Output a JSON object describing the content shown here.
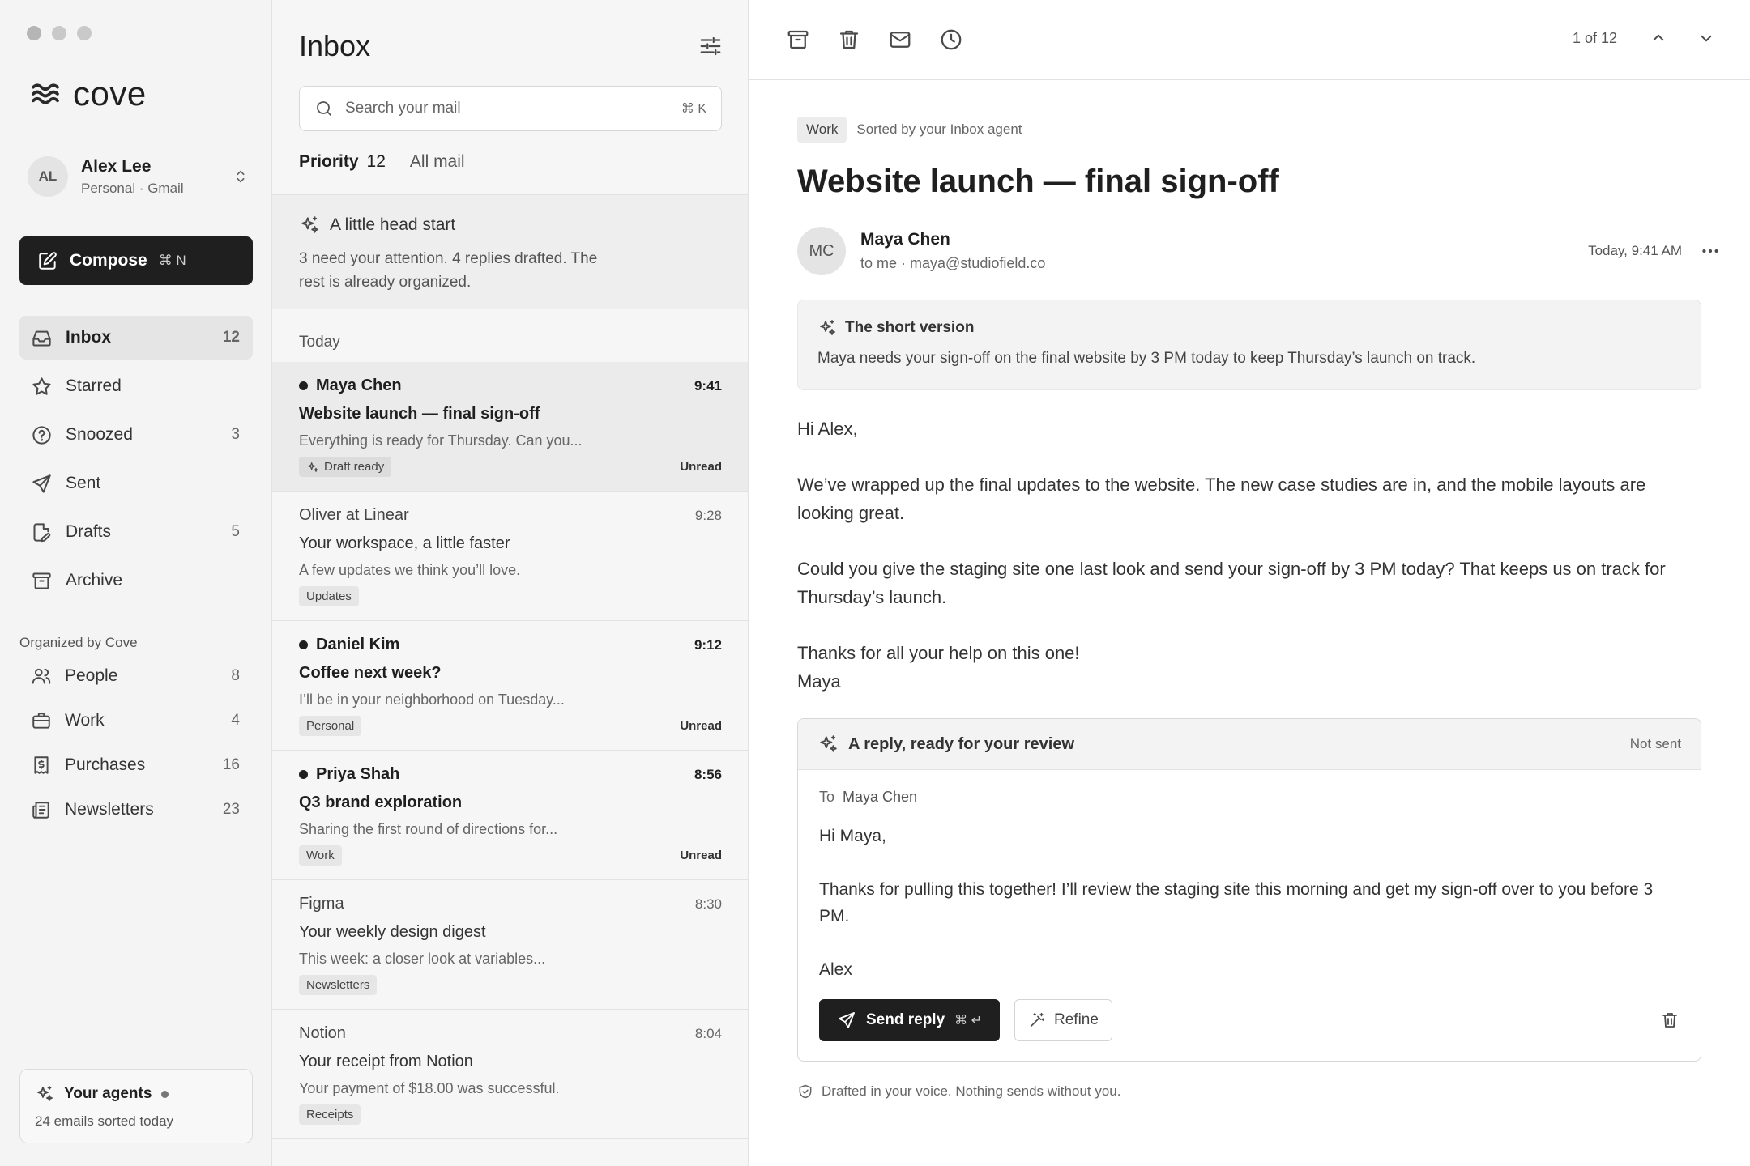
{
  "app": {
    "name": "cove"
  },
  "account": {
    "initials": "AL",
    "name": "Alex Lee",
    "sub": "Personal · Gmail"
  },
  "compose": {
    "label": "Compose",
    "shortcut": "⌘ N"
  },
  "nav": [
    {
      "label": "Inbox",
      "count": "12",
      "icon": "inbox-icon",
      "active": true
    },
    {
      "label": "Starred",
      "count": "",
      "icon": "star-icon"
    },
    {
      "label": "Snoozed",
      "count": "3",
      "icon": "clock-icon"
    },
    {
      "label": "Sent",
      "count": "",
      "icon": "send-icon"
    },
    {
      "label": "Drafts",
      "count": "5",
      "icon": "draft-icon"
    },
    {
      "label": "Archive",
      "count": "",
      "icon": "archive-icon"
    }
  ],
  "organized": {
    "label": "Organized by Cove",
    "items": [
      {
        "label": "People",
        "count": "8",
        "icon": "people-icon"
      },
      {
        "label": "Work",
        "count": "4",
        "icon": "briefcase-icon"
      },
      {
        "label": "Purchases",
        "count": "16",
        "icon": "receipt-icon"
      },
      {
        "label": "Newsletters",
        "count": "23",
        "icon": "newspaper-icon"
      }
    ]
  },
  "agents": {
    "title": "Your agents",
    "sub": "24 emails sorted today"
  },
  "list": {
    "title": "Inbox",
    "search_placeholder": "Search your mail",
    "search_shortcut": "⌘ K",
    "tabs": [
      {
        "label": "Priority",
        "count": "12"
      },
      {
        "label": "All mail",
        "count": ""
      }
    ],
    "head_start": {
      "title": "A little head start",
      "text": "3 need your attention. 4 replies drafted. The rest is already organized."
    },
    "section": "Today",
    "messages": [
      {
        "from": "Maya Chen",
        "time": "9:41",
        "subject": "Website launch — final sign-off",
        "snippet": "Everything is ready for Thursday. Can you...",
        "tag": "Draft ready",
        "status": "Unread"
      },
      {
        "from": "Oliver at Linear",
        "time": "9:28",
        "subject": "Your workspace, a little faster",
        "snippet": "A few updates we think you’ll love.",
        "tag": "Updates",
        "status": ""
      },
      {
        "from": "Daniel Kim",
        "time": "9:12",
        "subject": "Coffee next week?",
        "snippet": "I’ll be in your neighborhood on Tuesday...",
        "tag": "Personal",
        "status": "Unread"
      },
      {
        "from": "Priya Shah",
        "time": "8:56",
        "subject": "Q3 brand exploration",
        "snippet": "Sharing the first round of directions for...",
        "tag": "Work",
        "status": "Unread"
      },
      {
        "from": "Figma",
        "time": "8:30",
        "subject": "Your weekly design digest",
        "snippet": "This week: a closer look at variables...",
        "tag": "Newsletters",
        "status": ""
      },
      {
        "from": "Notion",
        "time": "8:04",
        "subject": "Your receipt from Notion",
        "snippet": "Your payment of $18.00 was successful.",
        "tag": "Receipts",
        "status": ""
      }
    ]
  },
  "reader": {
    "pager": "1 of 12",
    "tag": "Work",
    "sorted_note": "Sorted by your Inbox agent",
    "subject": "Website launch — final sign-off",
    "sender": {
      "initials": "MC",
      "name": "Maya Chen",
      "address": "to me · maya@studiofield.co",
      "date": "Today, 9:41 AM"
    },
    "summary": {
      "title": "The short version",
      "text": "Maya needs your sign-off on the final website by 3 PM today to keep Thursday’s launch on track."
    },
    "body": {
      "greeting": "Hi Alex,",
      "p1": "We’ve wrapped up the final updates to the website. The new case studies are in, and the mobile layouts are looking great.",
      "p2": "Could you give the staging site one last look and send your sign-off by 3 PM today? That keeps us on track for Thursday’s launch.",
      "closing": "Thanks for all your help on this one!",
      "signature": "Maya"
    },
    "reply": {
      "title": "A reply, ready for your review",
      "status": "Not sent",
      "to_label": "To",
      "to_name": "Maya Chen",
      "greeting": "Hi Maya,",
      "text": "Thanks for pulling this together! I’ll review the staging site this morning and get my sign-off over to you before 3 PM.",
      "signature": "Alex",
      "send_label": "Send reply",
      "send_shortcut": "⌘ ↵",
      "refine_label": "Refine"
    },
    "footnote": "Drafted in your voice. Nothing sends without you."
  }
}
